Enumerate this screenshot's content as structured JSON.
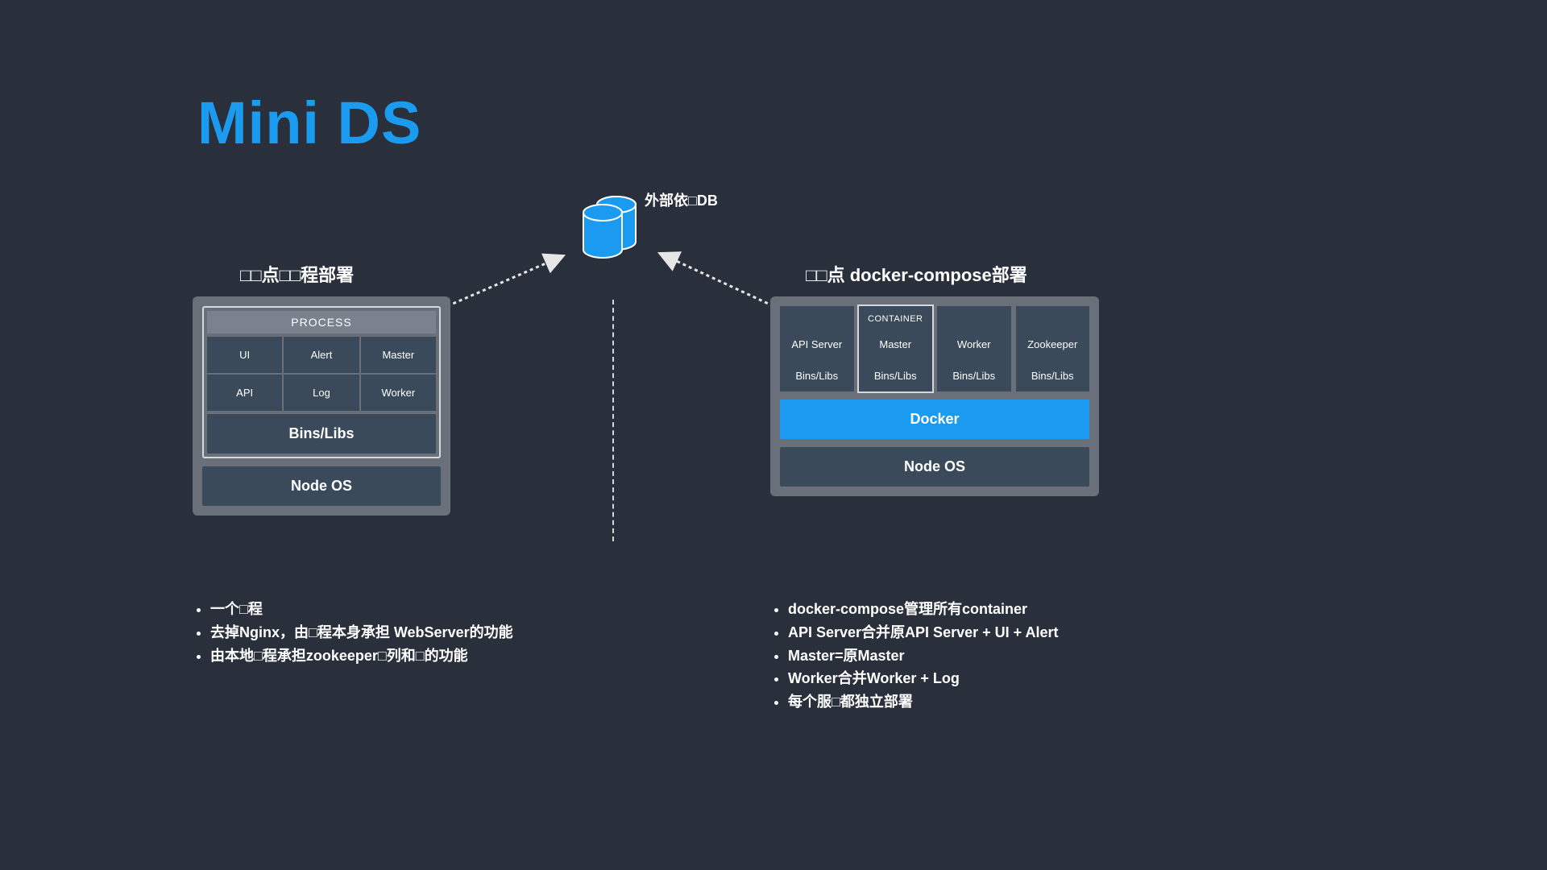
{
  "title": "Mini DS",
  "db": {
    "label": "外部依□DB"
  },
  "left": {
    "heading": "□□点□□程部署",
    "process_header": "PROCESS",
    "cells": [
      "UI",
      "Alert",
      "Master",
      "API",
      "Log",
      "Worker"
    ],
    "bins": "Bins/Libs",
    "node_os": "Node OS",
    "bullets": [
      "一个□程",
      "去掉Nginx，由□程本身承担 WebServer的功能",
      "由本地□程承担zookeeper□列和□的功能"
    ]
  },
  "right": {
    "heading": "□□点 docker-compose部署",
    "container_label": "CONTAINER",
    "cols": [
      {
        "name": "API Server",
        "bins": "Bins/Libs",
        "highlight": false
      },
      {
        "name": "Master",
        "bins": "Bins/Libs",
        "highlight": true
      },
      {
        "name": "Worker",
        "bins": "Bins/Libs",
        "highlight": false
      },
      {
        "name": "Zookeeper",
        "bins": "Bins/Libs",
        "highlight": false
      }
    ],
    "docker": "Docker",
    "node_os": "Node OS",
    "bullets": [
      "docker-compose管理所有container",
      "API Server合并原API Server + UI + Alert",
      "Master=原Master",
      "Worker合并Worker + Log",
      "每个服□都独立部署"
    ]
  },
  "colors": {
    "accent": "#1b9bf0",
    "bg": "#29303b",
    "cell": "#3a4a5a",
    "card": "#6a7079"
  }
}
